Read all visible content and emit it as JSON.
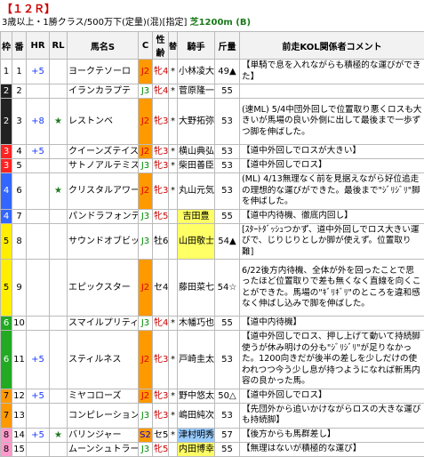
{
  "header": {
    "title": "【１２Ｒ】",
    "race_info": "3歳以上・1勝クラス/500万下(定量)(混)[指定]",
    "course": "芝1200m (B)"
  },
  "columns": [
    "枠",
    "番",
    "HR",
    "RL",
    "馬名S",
    "C",
    "性齢",
    "替",
    "騎手",
    "斤量",
    "前走KOL関係者コメント"
  ],
  "rows": [
    {
      "waku": "1",
      "ban": "1",
      "hr": "+5",
      "rl": "",
      "name": "ヨークテソーロ",
      "c": "J2",
      "sex": "牝4",
      "kae": "*",
      "jockey": "小林凌大",
      "kin": "49▲",
      "comment": "【単騎で息を入れながらも積極的な運びができた】"
    },
    {
      "waku": "2",
      "ban": "2",
      "hr": "",
      "rl": "",
      "name": "イランカラプテ",
      "c": "J3",
      "sex": "牝4",
      "kae": "*",
      "jockey": "菅原隆一",
      "kin": "55",
      "comment": ""
    },
    {
      "waku": "2",
      "ban": "3",
      "hr": "+8",
      "rl": "★",
      "name": "レストンベ",
      "c": "J2",
      "sex": "牝3",
      "kae": "*",
      "jockey": "大野拓弥",
      "kin": "53",
      "comment": "(速ML) 5/4中団外回しで位置取り悪くロスも大きいが馬場の良い外側に出して最後まで一歩ずつ脚を伸ばした。"
    },
    {
      "waku": "3",
      "ban": "4",
      "hr": "+5",
      "rl": "",
      "name": "クイーンズテイスト",
      "c": "J2",
      "sex": "牝3",
      "kae": "*",
      "jockey": "横山典弘",
      "kin": "53",
      "comment": "【道中外回しでロスが大きい】"
    },
    {
      "waku": "3",
      "ban": "5",
      "hr": "",
      "rl": "",
      "name": "サトノアルテミス",
      "c": "J3",
      "sex": "牝3",
      "kae": "*",
      "jockey": "柴田善臣",
      "kin": "53",
      "comment": "【道中外回しでロス】"
    },
    {
      "waku": "4",
      "ban": "6",
      "hr": "",
      "rl": "★",
      "name": "クリスタルアワード",
      "c": "J2",
      "sex": "牝3",
      "kae": "*",
      "jockey": "丸山元気",
      "kin": "53",
      "comment": "(ML) 4/13無理なく前を見据えながら好位追走の理想的な運びができた。最後まで\"ｼﾞﾘｼﾞﾘ\"脚を伸ばした。"
    },
    {
      "waku": "4",
      "ban": "7",
      "hr": "",
      "rl": "",
      "name": "パンドラフォンテン",
      "c": "J3",
      "sex": "牝5",
      "kae": "",
      "jockey": "吉田豊",
      "kin": "55",
      "comment": "【道中内待機、徹底内回し】"
    },
    {
      "waku": "5",
      "ban": "8",
      "hr": "",
      "rl": "",
      "name": "サウンドオブビット",
      "c": "J3",
      "sex": "牡6",
      "kae": "",
      "jockey": "山田敬士",
      "kin": "54▲",
      "comment": "[ｽﾀｰﾄﾀﾞｯｼｭつかず、道中外回しでロス大きい運びで、じりじりとしか脚が使えず。位置取り難]"
    },
    {
      "waku": "5",
      "ban": "9",
      "hr": "",
      "rl": "",
      "name": "エピックスター",
      "c": "J2",
      "sex": "セ4",
      "kae": "",
      "jockey": "藤田菜七",
      "kin": "54☆",
      "comment": "6/22後方内待機、全体が外を回ったことで思ったほど位置取りで差も無くなく直線を向くことができた。馬場の\"ｷﾞﾘｷﾞﾘ\"のところを違和感なく伸ばし込みで脚を伸ばした。"
    },
    {
      "waku": "6",
      "ban": "10",
      "hr": "",
      "rl": "",
      "name": "スマイルプリティ",
      "c": "J3",
      "sex": "牝4",
      "kae": "*",
      "jockey": "木幡巧也",
      "kin": "55",
      "comment": "【道中内待機】"
    },
    {
      "waku": "6",
      "ban": "11",
      "hr": "+5",
      "rl": "",
      "name": "スティルネス",
      "c": "J2",
      "sex": "牝3",
      "kae": "*",
      "jockey": "戸崎圭太",
      "kin": "53",
      "comment": "【道中外回しでロス、押し上げて動いて持続脚使うが休み明けの分も\"ｼﾞﾘｼﾞﾘ\"が足りなかった。1200向きだが後半の差しを少しだけの使われつつ今う少し息が持つようになれば新馬内容の良かった馬。"
    },
    {
      "waku": "7",
      "ban": "12",
      "hr": "+5",
      "rl": "",
      "name": "ミヤコローズ",
      "c": "J2",
      "sex": "牝3",
      "kae": "*",
      "jockey": "野中悠太",
      "kin": "50△",
      "comment": "【道中外回しでロス】"
    },
    {
      "waku": "7",
      "ban": "13",
      "hr": "",
      "rl": "",
      "name": "コンピレーション",
      "c": "J3",
      "sex": "牝3",
      "kae": "*",
      "jockey": "嶋田純次",
      "kin": "53",
      "comment": "【先団外から追いかけながらロスの大きな運びも持続脚】"
    },
    {
      "waku": "8",
      "ban": "14",
      "hr": "+5",
      "rl": "★",
      "name": "バリンジャー",
      "c": "S2",
      "sex": "セ5",
      "kae": "*",
      "jockey": "津村明秀",
      "kin": "57",
      "comment": "【後方からも馬群差し】"
    },
    {
      "waku": "8",
      "ban": "15",
      "hr": "",
      "rl": "",
      "name": "ムーンシュトラール",
      "c": "J3",
      "sex": "牝5",
      "kae": "",
      "jockey": "内田博幸",
      "kin": "55",
      "comment": "【無理はないが積極的な運び】"
    }
  ]
}
